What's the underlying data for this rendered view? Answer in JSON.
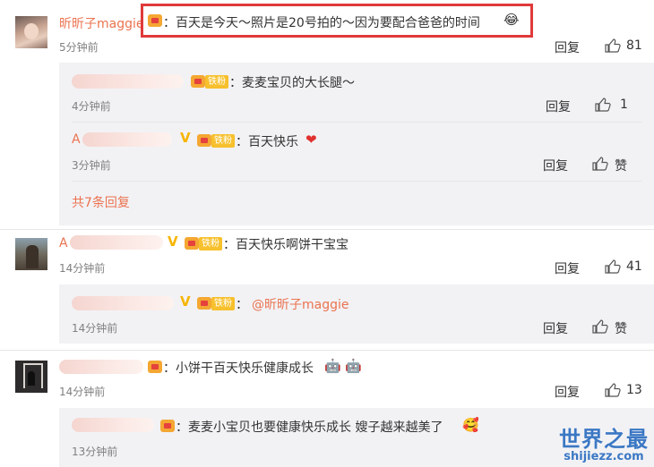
{
  "highlight_comment": {
    "user": "昕昕子maggie",
    "text": "：百天是今天～照片是20号拍的～因为要配合爸爸的时间",
    "time": "5分钟前",
    "reply_label": "回复",
    "likes": "81"
  },
  "reply_1": {
    "text": "：麦麦宝贝的大长腿～",
    "fan_badge": "铁粉",
    "time": "4分钟前",
    "reply_label": "回复",
    "likes": "1"
  },
  "reply_2": {
    "name_initial": "A",
    "text": "：百天快乐",
    "fan_badge": "铁粉",
    "time": "3分钟前",
    "reply_label": "回复",
    "like_label": "赞"
  },
  "more_replies": "共7条回复",
  "comment_2": {
    "name_initial": "A",
    "text": "：百天快乐啊饼干宝宝",
    "fan_badge": "铁粉",
    "time": "14分钟前",
    "reply_label": "回复",
    "likes": "41"
  },
  "reply_3": {
    "text_prefix": "：",
    "mention": "@昕昕子maggie",
    "fan_badge": "铁粉",
    "time": "14分钟前",
    "reply_label": "回复",
    "like_label": "赞"
  },
  "comment_3": {
    "text": "：小饼干百天快乐健康成长",
    "time": "14分钟前",
    "reply_label": "回复",
    "likes": "13"
  },
  "reply_4": {
    "text": "：麦麦小宝贝也要健康快乐成长 嫂子越来越美了",
    "time": "13分钟前"
  },
  "watermark": {
    "main": "世界之最",
    "sub": "shijiezz.com"
  },
  "colors": {
    "username": "#eb7350",
    "highlight_border": "#e03a3a",
    "reply_background": "#f2f2f5",
    "watermark": "#3b78c4"
  },
  "icons": [
    "like-thumb-icon",
    "crown-badge-icon",
    "verified-v-icon",
    "heart-emoji-icon",
    "laugh-emoji-icon",
    "robot-emoji-icon",
    "blush-emoji-icon"
  ]
}
